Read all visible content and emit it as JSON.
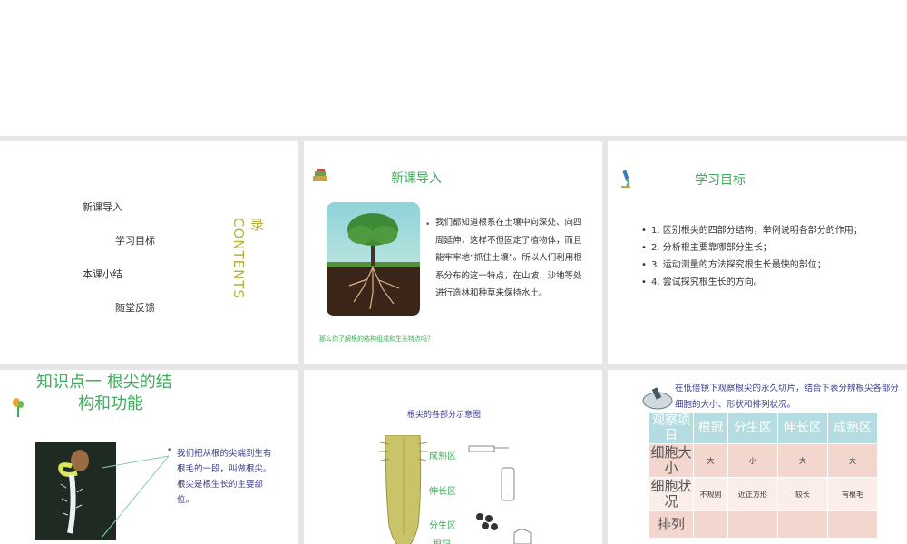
{
  "slide1": {
    "toc_items": [
      "新课导入",
      "学习目标",
      "本课小结",
      "随堂反馈"
    ],
    "title_cn": "录",
    "title_en": "CONTENTS"
  },
  "slide2": {
    "title": "新课导入",
    "paragraph": "我们都知道根系在土壤中向深处、向四周延伸，这样不但固定了植物体，而且能牢牢地“抓住土壤”。所以人们利用根系分布的这一特点，在山坡、沙地等处进行造林和种草来保持水土。",
    "question": "那么你了解根的结构组成和生长特点吗？"
  },
  "slide3": {
    "title": "学习目标",
    "goals": [
      "1. 区别根尖的四部分结构，举例说明各部分的作用；",
      "2. 分析根主要靠哪部分生长；",
      "3. 运动测量的方法探究根生长最快的部位；",
      "4. 尝试探究根生长的方向。"
    ]
  },
  "slide4": {
    "title_line1": "知识点一  根尖的结",
    "title_line2": "构和功能",
    "bullet_a": "我们把从根的尖端到生有根毛的一段，叫做根尖。",
    "bullet_b": "根尖是根生长的主要部位。"
  },
  "slide5": {
    "diagram_title": "根尖的各部分示意图",
    "labels": [
      "成熟区",
      "伸长区",
      "分生区",
      "根冠"
    ]
  },
  "slide6": {
    "instruction": "在低倍镜下观察根尖的永久切片，结合下表分辨根尖各部分细胞的大小、形状和排列状况。",
    "table": {
      "header": [
        "观察项目",
        "根冠",
        "分生区",
        "伸长区",
        "成熟区"
      ],
      "rows": [
        [
          "细胞大小",
          "大",
          "小",
          "大",
          "大"
        ],
        [
          "细胞状况",
          "不规则",
          "近正方形",
          "较长",
          "有根毛"
        ],
        [
          "排列",
          "",
          "",
          "",
          ""
        ]
      ]
    }
  },
  "colors": {
    "accent_green": "#3fae5a",
    "title_olive": "#b2b23a",
    "text_navy": "#3b3b8c",
    "table_header": "#b4dde1",
    "table_row": "#f3d6cd"
  }
}
